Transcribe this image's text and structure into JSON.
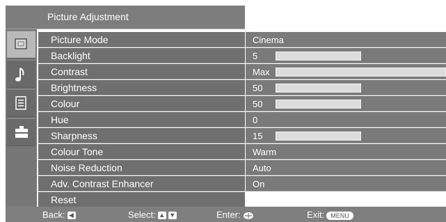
{
  "title": "Picture Adjustment",
  "sidebar": {
    "tabs": [
      {
        "icon": "picture-icon"
      },
      {
        "icon": "music-note-icon"
      },
      {
        "icon": "features-icon"
      },
      {
        "icon": "settings-toolbox-icon"
      }
    ]
  },
  "menu": {
    "items": [
      {
        "label": "Picture Mode",
        "value": "Cinema"
      },
      {
        "label": "Backlight",
        "value": "5",
        "level": 5,
        "max": 10
      },
      {
        "label": "Contrast",
        "value": "Max",
        "level": 100,
        "max": 100
      },
      {
        "label": "Brightness",
        "value": "50",
        "level": 50,
        "max": 100
      },
      {
        "label": "Colour",
        "value": "50",
        "level": 50,
        "max": 100
      },
      {
        "label": "Hue",
        "value": "0"
      },
      {
        "label": "Sharpness",
        "value": "15",
        "level": 15,
        "max": 30
      },
      {
        "label": "Colour Tone",
        "value": "Warm"
      },
      {
        "label": "Noise Reduction",
        "value": "Auto"
      },
      {
        "label": "Adv. Contrast Enhancer",
        "value": "On"
      },
      {
        "label": "Reset",
        "value": ""
      }
    ]
  },
  "footer": {
    "back": "Back:",
    "select": "Select:",
    "enter": "Enter:",
    "exit": "Exit:",
    "menu_key": "MENU"
  },
  "colors": {
    "label_bg": "#6f6f6f",
    "value_bg": "#7a7a7a",
    "bar_fill": "#dcdcdc"
  }
}
